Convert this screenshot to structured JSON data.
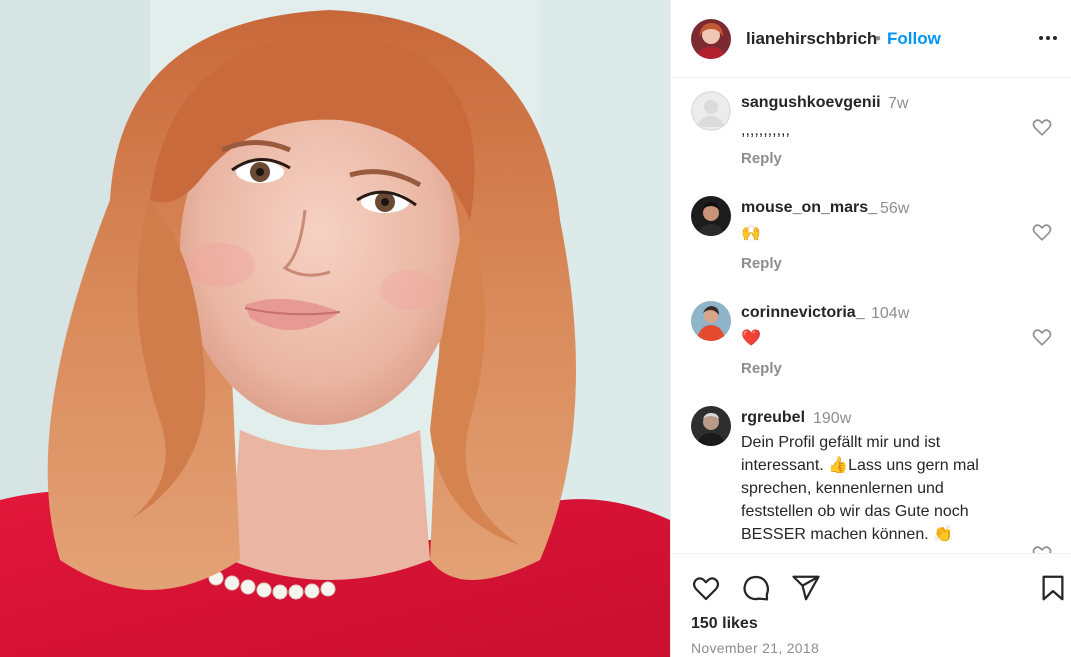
{
  "post": {
    "author": "lianehirschbrich",
    "separator": "•",
    "follow_label": "Follow",
    "more_icon": "more-horizontal-icon"
  },
  "comments": [
    {
      "username": "sangushkoevgenii",
      "time": "7w",
      "text": ",,,,,,,,,,,",
      "reply_label": "Reply"
    },
    {
      "username": "mouse_on_mars_",
      "time": "56w",
      "text": "🙌",
      "reply_label": "Reply"
    },
    {
      "username": "corinnevictoria_",
      "time": "104w",
      "text": "❤️",
      "reply_label": "Reply"
    },
    {
      "username": "rgreubel",
      "time": "190w",
      "text": "Dein Profil gefällt mir und ist interessant. 👍Lass uns gern mal sprechen, kennenlernen und feststellen ob wir das Gute noch BESSER machen können. 👏"
    }
  ],
  "actions": {
    "like_icon": "heart-icon",
    "comment_icon": "comment-icon",
    "share_icon": "share-icon",
    "save_icon": "bookmark-icon"
  },
  "likes": "150 likes",
  "date": "November 21, 2018",
  "colors": {
    "accent": "#0095f6",
    "text": "#262626",
    "muted": "#8e8e8e",
    "border": "#efefef",
    "heart": "#e0202e"
  }
}
